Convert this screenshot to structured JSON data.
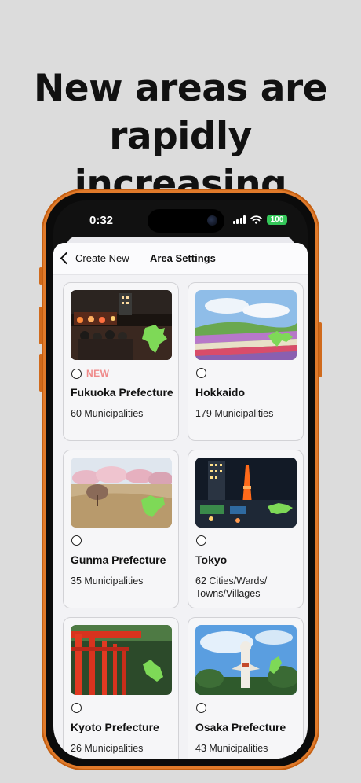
{
  "headline": {
    "line1": "New areas are",
    "line2": "rapidly increasing"
  },
  "status_bar": {
    "time": "0:32",
    "battery": "100"
  },
  "header": {
    "back_label": "Create New",
    "title": "Area Settings"
  },
  "areas": [
    {
      "name": "Fukuoka Prefecture",
      "count": "60 Municipalities",
      "badge": "NEW"
    },
    {
      "name": "Hokkaido",
      "count": "179 Municipalities"
    },
    {
      "name": "Gunma Prefecture",
      "count": "35 Municipalities"
    },
    {
      "name": "Tokyo",
      "count": "62 Cities/Wards/ Towns/Villages"
    },
    {
      "name": "Kyoto Prefecture",
      "count": "26 Municipalities"
    },
    {
      "name": "Osaka Prefecture",
      "count": "43 Municipalities"
    }
  ],
  "colors": {
    "frame": "#e07a2a",
    "badge": "#ef8a8a",
    "map_marker": "#7ed957",
    "battery": "#34c759"
  }
}
